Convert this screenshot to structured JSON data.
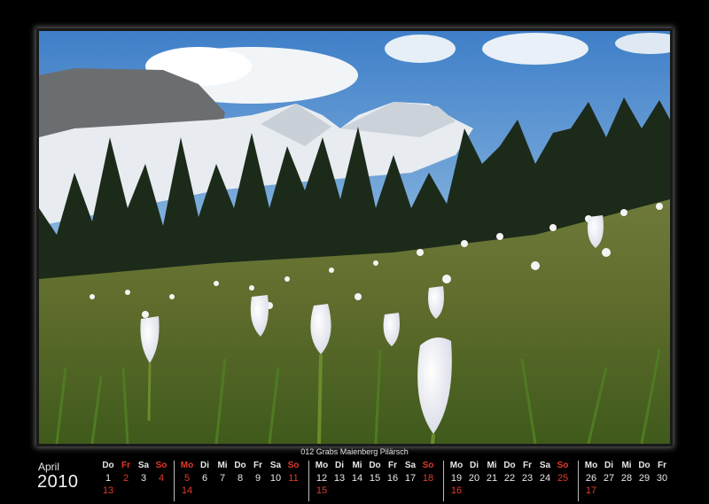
{
  "photo": {
    "description_icon": "mountain-meadow-crocus-photo"
  },
  "caption": "012 Grabs Maienberg Pilärsch",
  "calendar": {
    "month": "April",
    "year": "2010",
    "weeks": [
      {
        "days": [
          "Do",
          "Fr",
          "Sa",
          "So"
        ],
        "dates": [
          "1",
          "2",
          "3",
          "4"
        ],
        "sunday_holiday": "13",
        "red_days": [
          1,
          3
        ]
      },
      {
        "days": [
          "Mo",
          "Di",
          "Mi",
          "Do",
          "Fr",
          "Sa",
          "So"
        ],
        "dates": [
          "5",
          "6",
          "7",
          "8",
          "9",
          "10",
          "11"
        ],
        "sunday_holiday": "14",
        "red_days": [
          0,
          6
        ]
      },
      {
        "days": [
          "Mo",
          "Di",
          "Mi",
          "Do",
          "Fr",
          "Sa",
          "So"
        ],
        "dates": [
          "12",
          "13",
          "14",
          "15",
          "16",
          "17",
          "18"
        ],
        "sunday_holiday": "15",
        "red_days": [
          6
        ]
      },
      {
        "days": [
          "Mo",
          "Di",
          "Mi",
          "Do",
          "Fr",
          "Sa",
          "So"
        ],
        "dates": [
          "19",
          "20",
          "21",
          "22",
          "23",
          "24",
          "25"
        ],
        "sunday_holiday": "16",
        "red_days": [
          6
        ]
      },
      {
        "days": [
          "Mo",
          "Di",
          "Mi",
          "Do",
          "Fr"
        ],
        "dates": [
          "26",
          "27",
          "28",
          "29",
          "30"
        ],
        "sunday_holiday": "17",
        "red_days": []
      }
    ]
  },
  "colors": {
    "accent_red": "#e23a2a",
    "background": "#000000"
  }
}
